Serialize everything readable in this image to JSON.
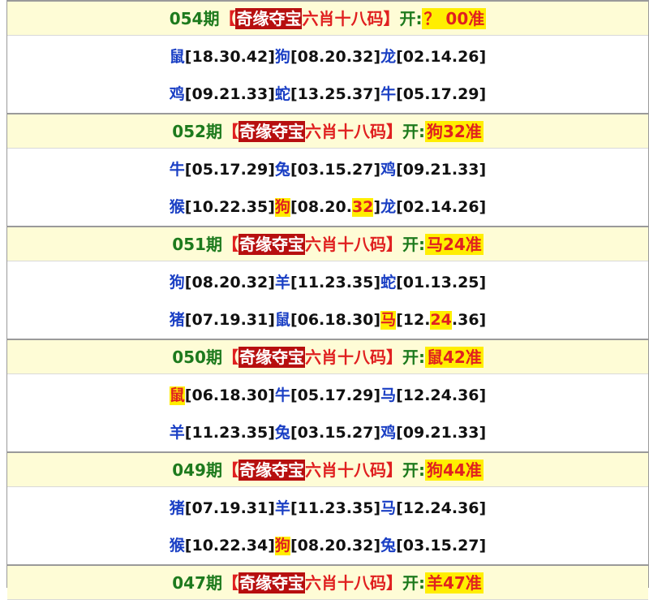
{
  "brand_label": "奇缘夺宝",
  "bracket_left": "【",
  "bracket_right": "】",
  "tag_label": "六肖十八码",
  "open_label": "开:",
  "blocks": [
    {
      "period": "054期",
      "result": "？ 00准",
      "rows": [
        [
          {
            "z": "鼠",
            "n": "[18.30.42]"
          },
          {
            "z": "狗",
            "n": "[08.20.32]"
          },
          {
            "z": "龙",
            "n": "[02.14.26]"
          }
        ],
        [
          {
            "z": "鸡",
            "n": "[09.21.33]"
          },
          {
            "z": "蛇",
            "n": "[13.25.37]"
          },
          {
            "z": "牛",
            "n": "[05.17.29]"
          }
        ]
      ]
    },
    {
      "period": "052期",
      "result": "狗32准",
      "rows": [
        [
          {
            "z": "牛",
            "n": "[05.17.29]"
          },
          {
            "z": "兔",
            "n": "[03.15.27]"
          },
          {
            "z": "鸡",
            "n": "[09.21.33]"
          }
        ],
        [
          {
            "z": "猴",
            "n": "[10.22.35]"
          },
          {
            "z": "狗",
            "zh": true,
            "np": [
              "[08.20.",
              "32",
              "]"
            ]
          },
          {
            "z": "龙",
            "n": "[02.14.26]"
          }
        ]
      ]
    },
    {
      "period": "051期",
      "result": "马24准",
      "rows": [
        [
          {
            "z": "狗",
            "n": "[08.20.32]"
          },
          {
            "z": "羊",
            "n": "[11.23.35]"
          },
          {
            "z": "蛇",
            "n": "[01.13.25]"
          }
        ],
        [
          {
            "z": "猪",
            "n": "[07.19.31]"
          },
          {
            "z": "鼠",
            "n": "[06.18.30]"
          },
          {
            "z": "马",
            "zh": true,
            "np": [
              "[12.",
              "24",
              ".36]"
            ]
          }
        ]
      ]
    },
    {
      "period": "050期",
      "result": "鼠42准",
      "rows": [
        [
          {
            "z": "鼠",
            "zh": true,
            "n": "[06.18.30]"
          },
          {
            "z": "牛",
            "n": "[05.17.29]"
          },
          {
            "z": "马",
            "n": "[12.24.36]"
          }
        ],
        [
          {
            "z": "羊",
            "n": "[11.23.35]"
          },
          {
            "z": "兔",
            "n": "[03.15.27]"
          },
          {
            "z": "鸡",
            "n": "[09.21.33]"
          }
        ]
      ]
    },
    {
      "period": "049期",
      "result": "狗44准",
      "rows": [
        [
          {
            "z": "猪",
            "n": "[07.19.31]"
          },
          {
            "z": "羊",
            "n": "[11.23.35]"
          },
          {
            "z": "马",
            "n": "[12.24.36]"
          }
        ],
        [
          {
            "z": "猴",
            "n": "[10.22.34]"
          },
          {
            "z": "狗",
            "zh": true,
            "n": "[08.20.32]"
          },
          {
            "z": "兔",
            "n": "[03.15.27]"
          }
        ]
      ]
    },
    {
      "period": "047期",
      "result": "羊47准",
      "rows": []
    }
  ],
  "colors": {
    "header_bg": "#fefcd6",
    "period_green": "#1d7a1d",
    "brand_bg": "#b70f0f",
    "accent_red": "#e02020",
    "highlight_yellow": "#ffee00",
    "zodiac_blue": "#1a3fc4"
  }
}
